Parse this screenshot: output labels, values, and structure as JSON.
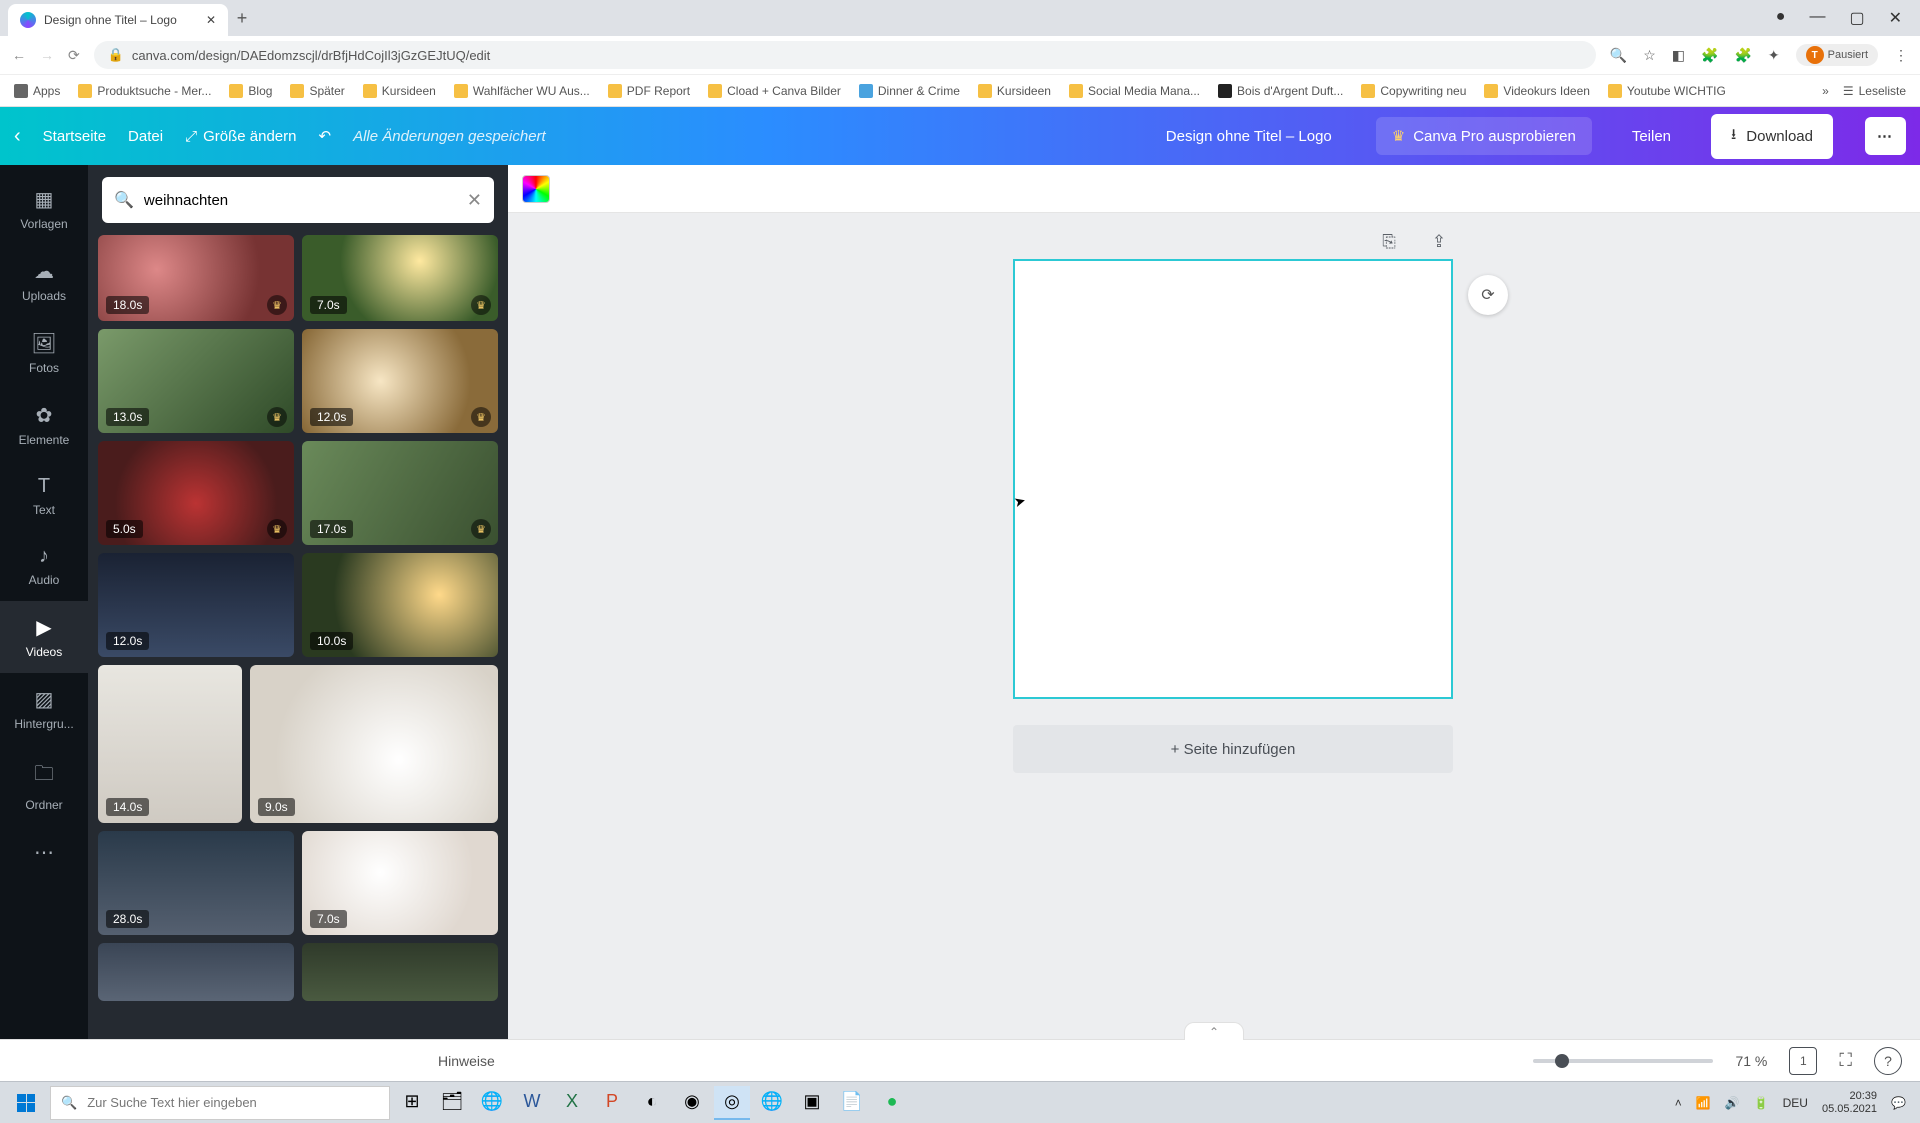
{
  "browser": {
    "tab_title": "Design ohne Titel – Logo",
    "url": "canva.com/design/DAEdomzscjl/drBfjHdCojIl3jGzGEJtUQ/edit",
    "pause_label": "Pausiert",
    "avatar_initial": "T"
  },
  "bookmarks": {
    "apps": "Apps",
    "items": [
      "Produktsuche - Mer...",
      "Blog",
      "Später",
      "Kursideen",
      "Wahlfächer WU Aus...",
      "PDF Report",
      "Cload + Canva Bilder",
      "Dinner & Crime",
      "Kursideen",
      "Social Media Mana...",
      "Bois d'Argent Duft...",
      "Copywriting neu",
      "Videokurs Ideen",
      "Youtube WICHTIG"
    ],
    "readlist": "Leseliste"
  },
  "topbar": {
    "home": "Startseite",
    "file": "Datei",
    "resize": "Größe ändern",
    "saved": "Alle Änderungen gespeichert",
    "title": "Design ohne Titel – Logo",
    "pro": "Canva Pro ausprobieren",
    "share": "Teilen",
    "download": "Download"
  },
  "rail": {
    "items": [
      "Vorlagen",
      "Uploads",
      "Fotos",
      "Elemente",
      "Text",
      "Audio",
      "Videos",
      "Hintergru...",
      "Ordner"
    ]
  },
  "search": {
    "value": "weihnachten"
  },
  "videos": [
    {
      "dur": "18.0s",
      "premium": true
    },
    {
      "dur": "7.0s",
      "premium": true
    },
    {
      "dur": "13.0s",
      "premium": true
    },
    {
      "dur": "12.0s",
      "premium": true
    },
    {
      "dur": "5.0s",
      "premium": true
    },
    {
      "dur": "17.0s",
      "premium": true
    },
    {
      "dur": "12.0s",
      "premium": false
    },
    {
      "dur": "10.0s",
      "premium": false
    },
    {
      "dur": "14.0s",
      "premium": false
    },
    {
      "dur": "9.0s",
      "premium": false
    },
    {
      "dur": "28.0s",
      "premium": false
    },
    {
      "dur": "7.0s",
      "premium": false
    }
  ],
  "canvas": {
    "add_page": "+ Seite hinzufügen"
  },
  "bottom": {
    "notes": "Hinweise",
    "zoom": "71 %",
    "page_num": "1"
  },
  "taskbar": {
    "search_placeholder": "Zur Suche Text hier eingeben",
    "lang": "DEU",
    "time": "20:39",
    "date": "05.05.2021"
  }
}
